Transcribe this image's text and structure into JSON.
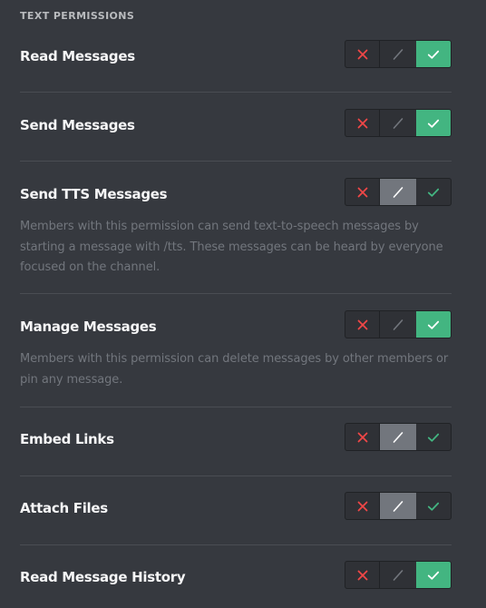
{
  "section": {
    "title": "TEXT PERMISSIONS"
  },
  "colors": {
    "background": "#36393f",
    "deny": "#f04747",
    "allow": "#43b581",
    "neutral_active": "#72767d"
  },
  "permissions": [
    {
      "name": "Read Messages",
      "description": "",
      "state": "allow"
    },
    {
      "name": "Send Messages",
      "description": "",
      "state": "allow"
    },
    {
      "name": "Send TTS Messages",
      "description": "Members with this permission can send text-to-speech messages by starting a message with /tts. These messages can be heard by everyone focused on the channel.",
      "state": "neutral"
    },
    {
      "name": "Manage Messages",
      "description": "Members with this permission can delete messages by other members or pin any message.",
      "state": "allow"
    },
    {
      "name": "Embed Links",
      "description": "",
      "state": "neutral"
    },
    {
      "name": "Attach Files",
      "description": "",
      "state": "neutral"
    },
    {
      "name": "Read Message History",
      "description": "",
      "state": "allow"
    }
  ],
  "toggle_options": {
    "deny": "x-icon",
    "neutral": "slash-icon",
    "allow": "check-icon"
  }
}
